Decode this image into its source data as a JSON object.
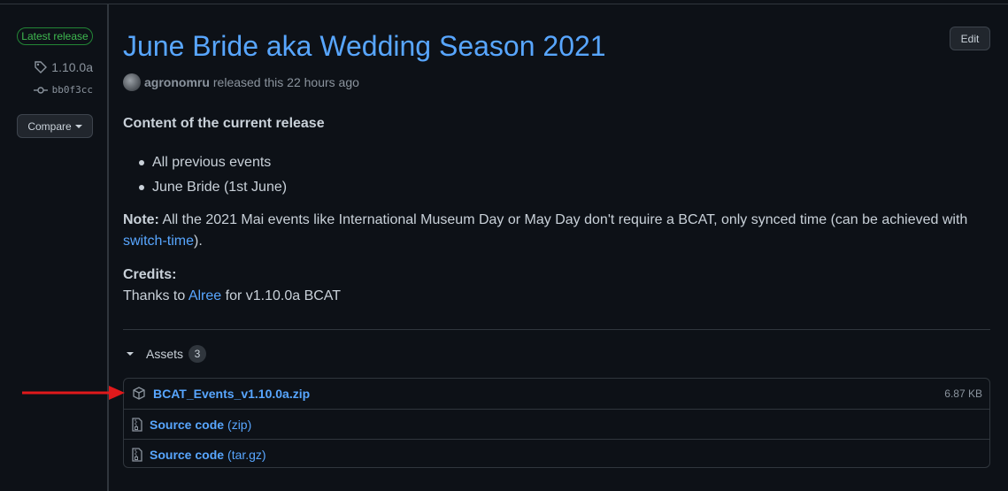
{
  "sidebar": {
    "latest_label": "Latest release",
    "tag": "1.10.0a",
    "commit": "bb0f3cc",
    "compare_label": "Compare"
  },
  "release": {
    "title": "June Bride aka Wedding Season 2021",
    "edit_label": "Edit",
    "author": "agronomru",
    "released_text": "released this 22 hours ago",
    "content_heading": "Content of the current release",
    "items": [
      "All previous events",
      "June Bride (1st June)"
    ],
    "note_label": "Note:",
    "note_text": " All the 2021 Mai events like International Museum Day or May Day don't require a BCAT, only synced time (can be achieved with ",
    "note_link": "switch-time",
    "note_end": ").",
    "credits_heading": "Credits:",
    "credits_prefix": "Thanks to ",
    "credits_link": "Alree",
    "credits_suffix": " for v1.10.0a BCAT"
  },
  "assets": {
    "heading": "Assets",
    "count": "3",
    "files": [
      {
        "name": "BCAT_Events_v1.10.0a.zip",
        "ext": "",
        "size": "6.87 KB",
        "icon": "package-icon"
      },
      {
        "name": "Source code",
        "ext": "(zip)",
        "size": "",
        "icon": "file-zip-icon"
      },
      {
        "name": "Source code",
        "ext": "(tar.gz)",
        "size": "",
        "icon": "file-zip-icon"
      }
    ]
  },
  "colors": {
    "link": "#58a6ff",
    "background": "#0d1117",
    "annotation_arrow": "#e0191b"
  }
}
